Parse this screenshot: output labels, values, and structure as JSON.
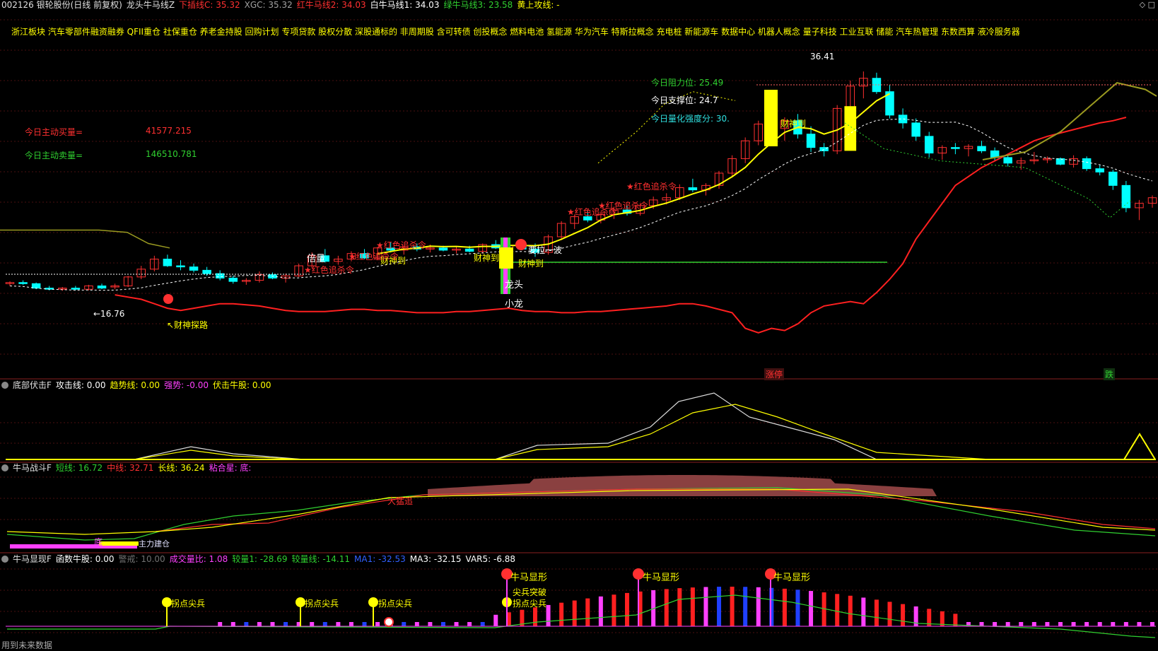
{
  "header": {
    "stock": "002126 银轮股份(日线 前复权)",
    "indicator": "龙头牛马线Z",
    "items": [
      {
        "label": "下插线C: 35.32",
        "color": "#ff3030"
      },
      {
        "label": "XGC: 35.32",
        "color": "#a0a0a0"
      },
      {
        "label": "红牛马线2: 34.03",
        "color": "#ff3030"
      },
      {
        "label": "白牛马线1: 34.03",
        "color": "#ffffff"
      },
      {
        "label": "绿牛马线3: 23.58",
        "color": "#30d030"
      },
      {
        "label": "黄上攻线: -",
        "color": "#ffff00"
      }
    ]
  },
  "concepts": "浙江板块  汽车零部件融资融券 QFII重仓 社保重仓 养老金持股 回购计划 专项贷款 股权分散 深股通标的 非周期股  含可转债 创投概念 燃料电池 氢能源 华为汽车 特斯拉概念 充电桩 新能源车 数据中心 机器人概念 量子科技 工业互联 储能 汽车热管理 东数西算 液冷服务器",
  "buy_label": "今日主动买量=",
  "buy_value": "41577.215",
  "sell_label": "今日主动卖量=",
  "sell_value": "146510.781",
  "price_labels": {
    "resist": "今日阻力位:  25.49",
    "support": "今日支撑位:  24.7",
    "score": "今日量化强度分:  30.",
    "high": "36.41",
    "low": "←16.76",
    "beiliang": "倍量",
    "longtou": "龙头",
    "xiaolong": "小龙",
    "caishen_tanlu": "↖财神探路",
    "caishen_dao": "财神到",
    "zhangting": "涨停",
    "die": "跌",
    "hongse": "★红色追杀令",
    "yila": "要拉一波"
  },
  "panel1": {
    "name": "底部伏击F",
    "items": [
      {
        "label": "攻击线: 0.00",
        "color": "#ffffff"
      },
      {
        "label": "趋势线: 0.00",
        "color": "#ffff00"
      },
      {
        "label": "强势: -0.00",
        "color": "#ff40ff"
      },
      {
        "label": "伏击牛股: 0.00",
        "color": "#ffff00"
      }
    ]
  },
  "panel2": {
    "name": "牛马战斗F",
    "items": [
      {
        "label": "短线: 16.72",
        "color": "#30d030"
      },
      {
        "label": "中线: 32.71",
        "color": "#ff3030"
      },
      {
        "label": "长线: 36.24",
        "color": "#ffff00"
      },
      {
        "label": "粘合星: 底:",
        "color": "#ff40ff"
      }
    ],
    "anno1": "底",
    "anno2": "主力建仓",
    "anno3": "大猛追"
  },
  "panel3": {
    "name": "牛马显现F",
    "items": [
      {
        "label": "函数牛股: 0.00",
        "color": "#ffffff"
      },
      {
        "label": "警戒: 10.00",
        "color": "#707070"
      },
      {
        "label": "成交量比: 1.08",
        "color": "#ff40ff"
      },
      {
        "label": "较量1: -28.69",
        "color": "#30d030"
      },
      {
        "label": "较量线: -14.11",
        "color": "#30d030"
      },
      {
        "label": "MA1: -32.53",
        "color": "#3060ff"
      },
      {
        "label": "MA3: -32.15",
        "color": "#ffffff"
      },
      {
        "label": "VAR5: -6.88",
        "color": "#ffffff"
      }
    ],
    "guaidian": "拐点尖兵",
    "xianxing": "牛马显形",
    "tupo": "尖兵突破"
  },
  "footer": "用到未来数据",
  "chart_data": [
    {
      "type": "candlestick",
      "title": "龙头牛马线Z",
      "ylim": [
        14,
        38
      ],
      "series": [
        {
          "name": "白牛马线1",
          "color": "#ffffff"
        },
        {
          "name": "红牛马线2",
          "color": "#ff3030"
        },
        {
          "name": "绿牛马线3",
          "color": "#30d030"
        },
        {
          "name": "黄上攻线",
          "color": "#ffff00"
        }
      ],
      "ohlc": [
        [
          17.4,
          17.6,
          17.2,
          17.5
        ],
        [
          17.5,
          17.7,
          17.3,
          17.4
        ],
        [
          17.4,
          17.5,
          16.9,
          17.0
        ],
        [
          17.0,
          17.2,
          16.8,
          16.9
        ],
        [
          16.9,
          17.1,
          16.76,
          17.0
        ],
        [
          17.0,
          17.2,
          16.8,
          16.9
        ],
        [
          16.9,
          17.3,
          16.8,
          17.2
        ],
        [
          17.2,
          17.4,
          16.9,
          17.0
        ],
        [
          17.1,
          17.4,
          16.9,
          17.2
        ],
        [
          17.2,
          18.1,
          17.1,
          18.0
        ],
        [
          18.0,
          19.0,
          17.8,
          18.7
        ],
        [
          18.7,
          19.9,
          18.5,
          19.6
        ],
        [
          19.6,
          20.0,
          18.9,
          19.0
        ],
        [
          19.0,
          19.5,
          18.6,
          18.9
        ],
        [
          18.9,
          19.2,
          18.4,
          18.6
        ],
        [
          18.6,
          18.9,
          18.1,
          18.3
        ],
        [
          18.3,
          18.6,
          17.7,
          17.9
        ],
        [
          17.9,
          18.1,
          17.4,
          17.6
        ],
        [
          17.6,
          17.9,
          17.3,
          17.7
        ],
        [
          17.7,
          18.5,
          17.5,
          18.2
        ],
        [
          18.2,
          18.4,
          17.8,
          17.9
        ],
        [
          17.9,
          18.3,
          17.5,
          18.1
        ],
        [
          18.1,
          19.2,
          18.0,
          19.0
        ],
        [
          19.0,
          20.2,
          18.8,
          19.9
        ],
        [
          19.9,
          20.5,
          19.3,
          19.4
        ],
        [
          19.4,
          19.9,
          19.1,
          19.6
        ],
        [
          19.6,
          20.3,
          19.4,
          20.1
        ],
        [
          20.1,
          20.5,
          19.6,
          19.7
        ],
        [
          19.7,
          20.7,
          19.5,
          20.6
        ],
        [
          20.6,
          21.1,
          20.2,
          20.4
        ],
        [
          20.4,
          20.8,
          20.0,
          20.7
        ],
        [
          20.7,
          21.0,
          20.3,
          20.5
        ],
        [
          20.5,
          20.9,
          20.2,
          20.6
        ],
        [
          20.6,
          20.8,
          20.3,
          20.4
        ],
        [
          20.4,
          20.7,
          20.1,
          20.5
        ],
        [
          20.5,
          20.8,
          20.2,
          20.3
        ],
        [
          20.3,
          21.0,
          20.1,
          20.9
        ],
        [
          20.9,
          21.3,
          20.5,
          20.6
        ],
        [
          20.6,
          20.9,
          20.2,
          20.8
        ],
        [
          20.8,
          21.2,
          20.4,
          20.5
        ],
        [
          20.5,
          21.0,
          19.8,
          20.2
        ],
        [
          20.2,
          21.8,
          20.0,
          21.6
        ],
        [
          21.6,
          23.0,
          21.3,
          22.8
        ],
        [
          22.8,
          23.6,
          22.3,
          23.4
        ],
        [
          23.4,
          23.9,
          22.9,
          23.1
        ],
        [
          23.1,
          23.8,
          22.8,
          23.6
        ],
        [
          23.6,
          24.3,
          23.2,
          24.0
        ],
        [
          24.0,
          24.4,
          23.5,
          23.7
        ],
        [
          23.7,
          24.6,
          23.5,
          24.4
        ],
        [
          24.4,
          25.2,
          24.1,
          24.9
        ],
        [
          24.9,
          25.5,
          24.5,
          25.1
        ],
        [
          25.1,
          26.3,
          24.9,
          26.0
        ],
        [
          26.0,
          26.8,
          25.6,
          25.8
        ],
        [
          25.8,
          26.4,
          25.3,
          26.2
        ],
        [
          26.2,
          27.5,
          25.9,
          27.3
        ],
        [
          27.3,
          28.9,
          27.0,
          28.6
        ],
        [
          28.6,
          30.5,
          28.2,
          30.2
        ],
        [
          30.2,
          32.0,
          29.8,
          31.7
        ],
        [
          31.7,
          32.5,
          31.0,
          31.3
        ],
        [
          31.3,
          32.3,
          30.2,
          32.0
        ],
        [
          32.0,
          32.6,
          30.4,
          30.8
        ],
        [
          30.8,
          31.5,
          29.2,
          29.6
        ],
        [
          29.6,
          30.0,
          28.8,
          29.3
        ],
        [
          29.3,
          33.4,
          29.0,
          33.1
        ],
        [
          33.1,
          35.6,
          32.5,
          35.1
        ],
        [
          35.1,
          36.41,
          34.0,
          35.8
        ],
        [
          35.8,
          36.3,
          34.4,
          34.6
        ],
        [
          34.6,
          35.2,
          32.2,
          32.5
        ],
        [
          32.5,
          33.1,
          31.3,
          31.8
        ],
        [
          31.8,
          32.2,
          30.2,
          30.6
        ],
        [
          30.6,
          31.0,
          28.7,
          29.1
        ],
        [
          29.1,
          29.8,
          28.5,
          29.6
        ],
        [
          29.6,
          30.0,
          29.0,
          29.5
        ],
        [
          29.5,
          29.9,
          28.8,
          29.7
        ],
        [
          29.7,
          30.2,
          29.1,
          29.3
        ],
        [
          29.3,
          29.6,
          28.4,
          28.7
        ],
        [
          28.7,
          29.0,
          27.9,
          28.2
        ],
        [
          28.2,
          28.7,
          27.6,
          28.4
        ],
        [
          28.4,
          29.2,
          28.1,
          28.5
        ],
        [
          28.5,
          28.8,
          28.2,
          28.6
        ],
        [
          28.6,
          28.7,
          28.0,
          28.1
        ],
        [
          28.1,
          28.9,
          27.8,
          28.6
        ],
        [
          28.6,
          28.8,
          27.5,
          27.7
        ],
        [
          27.7,
          28.0,
          27.1,
          27.4
        ],
        [
          27.4,
          27.6,
          25.8,
          26.2
        ],
        [
          26.2,
          26.6,
          23.8,
          24.2
        ],
        [
          24.2,
          24.9,
          23.1,
          24.6
        ],
        [
          24.6,
          25.3,
          24.2,
          25.1
        ]
      ]
    }
  ]
}
